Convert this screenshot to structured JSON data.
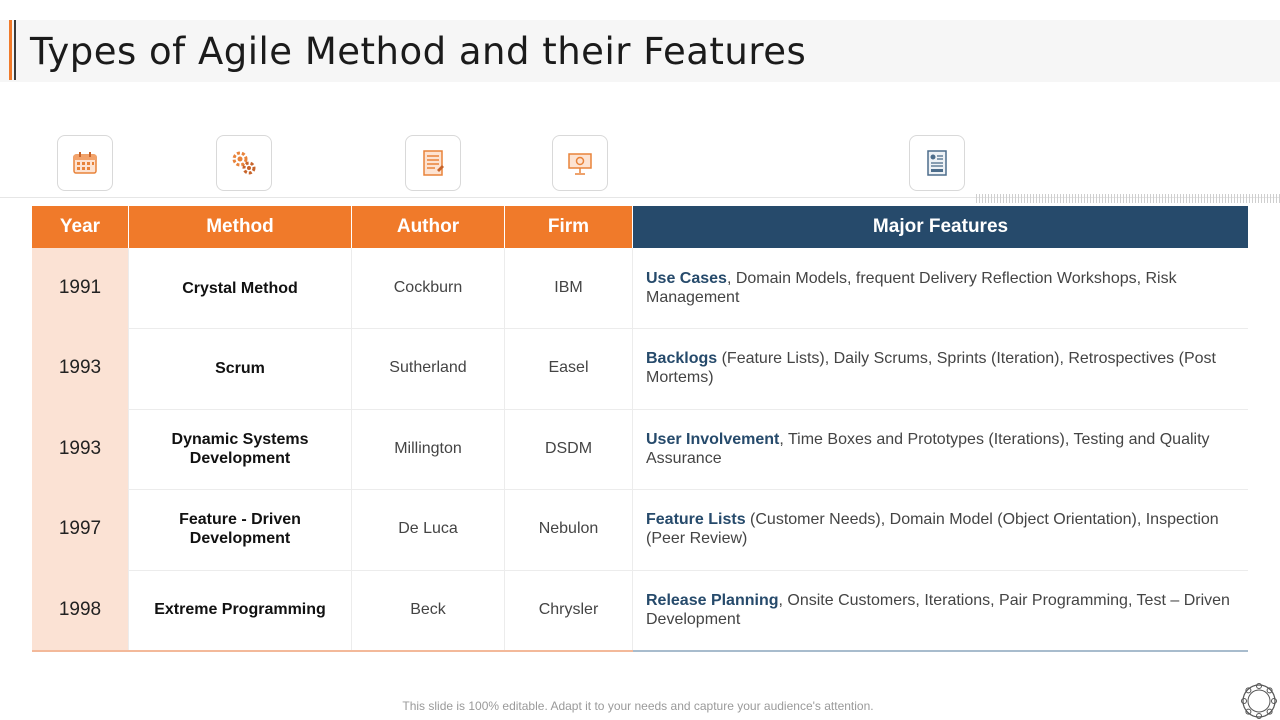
{
  "title": "Types of Agile Method and their Features",
  "icons": [
    "calendar-icon",
    "gears-icon",
    "document-icon",
    "presentation-icon",
    "report-icon"
  ],
  "colors": {
    "accent": "#f07a2a",
    "navy": "#264a6b",
    "year_fill": "#fbe2d4"
  },
  "table": {
    "headers": {
      "year": "Year",
      "method": "Method",
      "author": "Author",
      "firm": "Firm",
      "features": "Major Features"
    },
    "rows": [
      {
        "year": "1991",
        "method": "Crystal Method",
        "author": "Cockburn",
        "firm": "IBM",
        "feature_lead": "Use Cases",
        "feature_rest": ", Domain Models, frequent Delivery Reflection Workshops, Risk Management"
      },
      {
        "year": "1993",
        "method": "Scrum",
        "author": "Sutherland",
        "firm": "Easel",
        "feature_lead": "Backlogs",
        "feature_rest": " (Feature Lists), Daily Scrums, Sprints (Iteration), Retrospectives (Post Mortems)"
      },
      {
        "year": "1993",
        "method": "Dynamic Systems Development",
        "author": "Millington",
        "firm": "DSDM",
        "feature_lead": "User Involvement",
        "feature_rest": ", Time Boxes and Prototypes (Iterations), Testing and Quality Assurance"
      },
      {
        "year": "1997",
        "method": "Feature - Driven Development",
        "author": "De Luca",
        "firm": "Nebulon",
        "feature_lead": "Feature Lists",
        "feature_rest": " (Customer Needs), Domain Model (Object Orientation), Inspection (Peer Review)"
      },
      {
        "year": "1998",
        "method": "Extreme Programming",
        "author": "Beck",
        "firm": "Chrysler",
        "feature_lead": "Release Planning",
        "feature_rest": ", Onsite Customers, Iterations, Pair Programming, Test – Driven Development"
      }
    ]
  },
  "footer": "This slide is 100% editable. Adapt it to your needs and capture your audience's attention."
}
